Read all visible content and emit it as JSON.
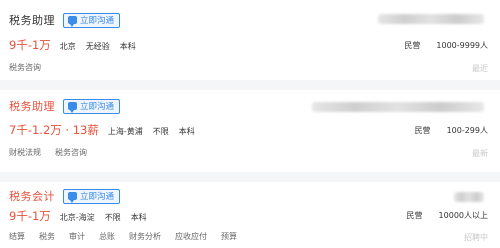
{
  "chat_label": "立即沟通",
  "jobs": [
    {
      "title": "税务助理",
      "salary": "9千-1万",
      "meta": [
        "北京",
        "无经验",
        "本科"
      ],
      "company_type": "民营",
      "company_size": "1000-9999人",
      "tags": [
        "税务咨询"
      ],
      "right_text": "最近"
    },
    {
      "title": "税务助理",
      "salary": "7千-1.2万 · 13薪",
      "meta": [
        "上海-黄浦",
        "不限",
        "本科"
      ],
      "company_type": "民营",
      "company_size": "100-299人",
      "tags": [
        "财税法规",
        "税务咨询"
      ],
      "right_text": "最新"
    },
    {
      "title": "税务会计",
      "salary": "9千-1万",
      "meta": [
        "北京-海淀",
        "不限",
        "本科"
      ],
      "company_type": "民营",
      "company_size": "10000人以上",
      "tags": [
        "结算",
        "税务",
        "审计",
        "总账",
        "财务分析",
        "应收应付",
        "预算"
      ],
      "right_text": "招聘中"
    }
  ]
}
